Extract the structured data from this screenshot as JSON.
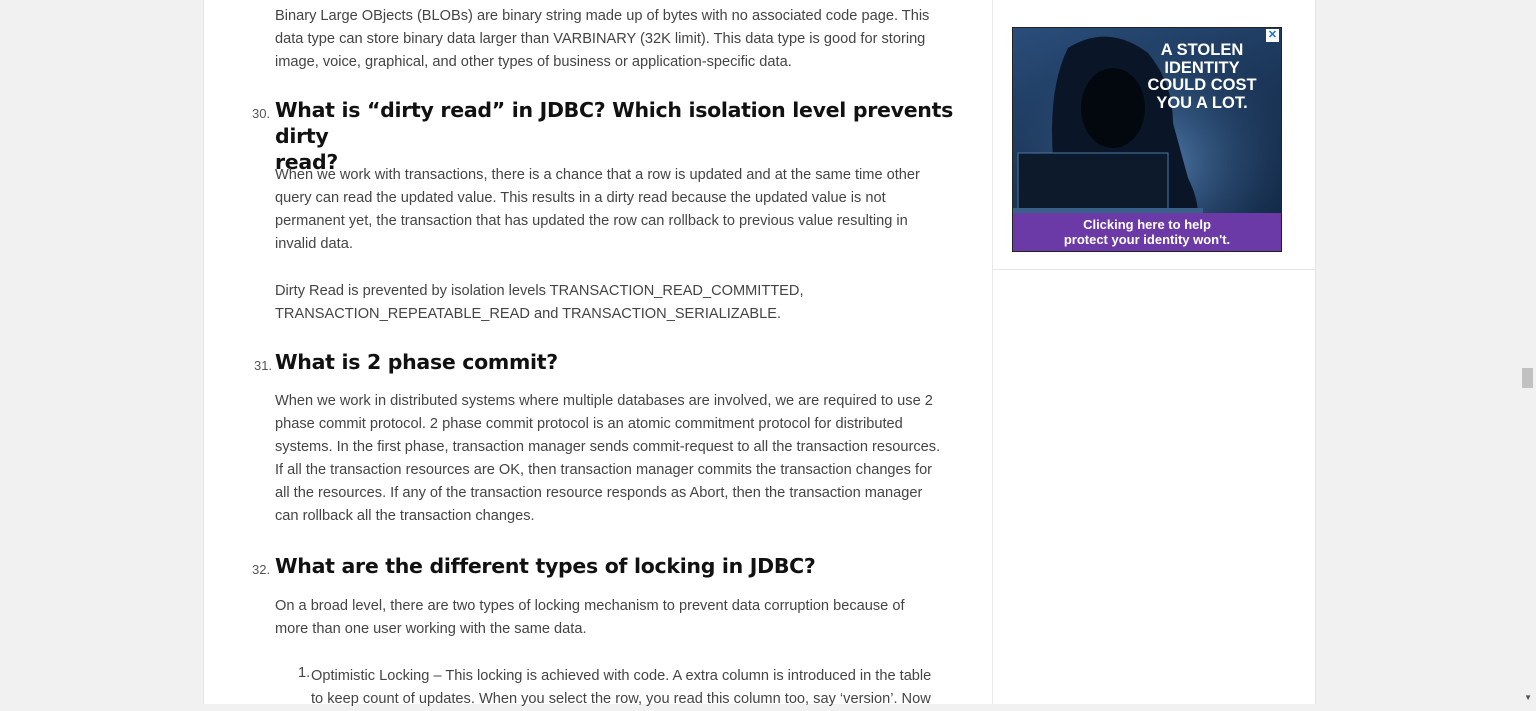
{
  "article": {
    "blob_para": [
      "Binary Large OBjects (BLOBs) are binary string made up of bytes with no associated code page. This",
      "data type can store binary data larger than VARBINARY (32K limit). This data type is good for storing",
      "image, voice, graphical, and other types of business or application-specific data."
    ],
    "q30": {
      "number": "30.",
      "title_line1": "What is “dirty read” in JDBC? Which isolation level prevents dirty",
      "title_line2": "read?",
      "para1": [
        "When we work with transactions, there is a chance that a row is updated and at the same time other",
        "query can read the updated value. This results in a dirty read because the updated value is not",
        "permanent yet, the transaction that has updated the row can rollback to previous value resulting in",
        "invalid data."
      ],
      "para2": [
        "Dirty Read is prevented by isolation levels TRANSACTION_READ_COMMITTED,",
        "TRANSACTION_REPEATABLE_READ and TRANSACTION_SERIALIZABLE."
      ]
    },
    "q31": {
      "number": "31.",
      "title": "What is 2 phase commit?",
      "para": [
        "When we work in distributed systems where multiple databases are involved, we are required to use 2",
        "phase commit protocol. 2 phase commit protocol is an atomic commitment protocol for distributed",
        "systems. In the first phase, transaction manager sends commit-request to all the transaction resources.",
        "If all the transaction resources are OK, then transaction manager commits the transaction changes for",
        "all the resources. If any of the transaction resource responds as Abort, then the transaction manager",
        "can rollback all the transaction changes."
      ]
    },
    "q32": {
      "number": "32.",
      "title": "What are the different types of locking in JDBC?",
      "para": [
        "On a broad level, there are two types of locking mechanism to prevent data corruption because of",
        "more than one user working with the same data."
      ],
      "list_item_num": "1.",
      "list_item": [
        "Optimistic Locking – This locking is achieved with code. A extra column is introduced in the table",
        "to keep count of updates. When you select the row, you read this column too, say ‘version’. Now"
      ]
    }
  },
  "ad": {
    "close_icon": "close-icon",
    "headline": [
      "A STOLEN",
      "IDENTITY",
      "COULD COST",
      "YOU A LOT."
    ],
    "footer": [
      "Clicking here to help",
      "protect your identity won't."
    ],
    "colors": {
      "background": "#1b3658",
      "footer": "#6c3aa6"
    }
  }
}
